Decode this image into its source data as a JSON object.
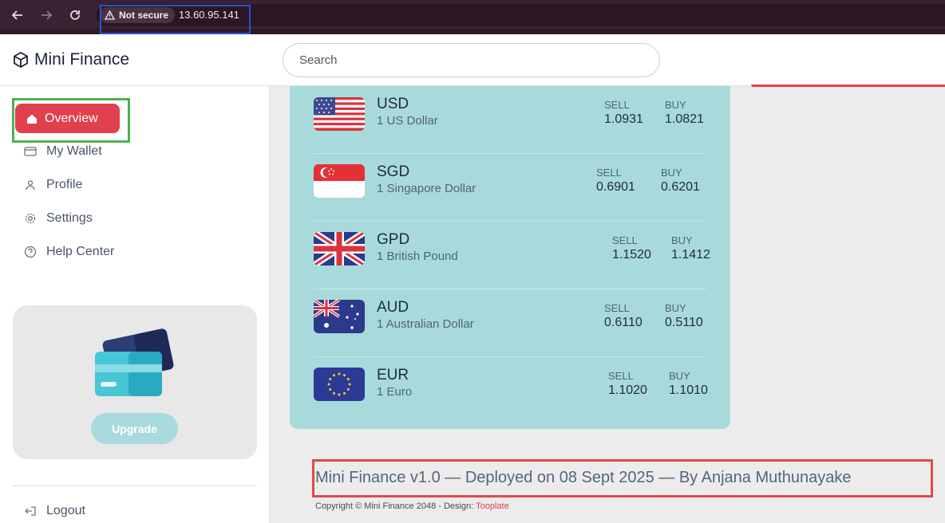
{
  "browser": {
    "security_label": "Not secure",
    "url": "13.60.95.141"
  },
  "header": {
    "app_title": "Mini Finance",
    "search_placeholder": "Search"
  },
  "sidebar": {
    "items": [
      {
        "label": "Overview",
        "icon": "home-icon",
        "active": true
      },
      {
        "label": "My Wallet",
        "icon": "wallet-icon"
      },
      {
        "label": "Profile",
        "icon": "user-icon"
      },
      {
        "label": "Settings",
        "icon": "gear-icon"
      },
      {
        "label": "Help Center",
        "icon": "help-icon"
      }
    ],
    "upgrade_label": "Upgrade",
    "logout_label": "Logout"
  },
  "exchange": {
    "sell_label": "SELL",
    "buy_label": "BUY",
    "rates": [
      {
        "code": "USD",
        "name": "1 US Dollar",
        "sell": "1.0931",
        "buy": "1.0821",
        "flag": "us-flag"
      },
      {
        "code": "SGD",
        "name": "1 Singapore Dollar",
        "sell": "0.6901",
        "buy": "0.6201",
        "flag": "sg-flag"
      },
      {
        "code": "GPD",
        "name": "1 British Pound",
        "sell": "1.1520",
        "buy": "1.1412",
        "flag": "uk-flag"
      },
      {
        "code": "AUD",
        "name": "1 Australian Dollar",
        "sell": "0.6110",
        "buy": "0.5110",
        "flag": "au-flag"
      },
      {
        "code": "EUR",
        "name": "1 Euro",
        "sell": "1.1020",
        "buy": "1.1010",
        "flag": "eu-flag"
      }
    ]
  },
  "footer": {
    "deploy_note": "Mini Finance v1.0 — Deployed on 08 Sept 2025 — By Anjana Muthunayake",
    "copyright": "Copyright © Mini Finance 2048 - Design: ",
    "design_link": "Tooplate"
  },
  "colors": {
    "accent": "#e1404e",
    "panel": "#a8dadc",
    "browser_frame": "#3b2233"
  }
}
